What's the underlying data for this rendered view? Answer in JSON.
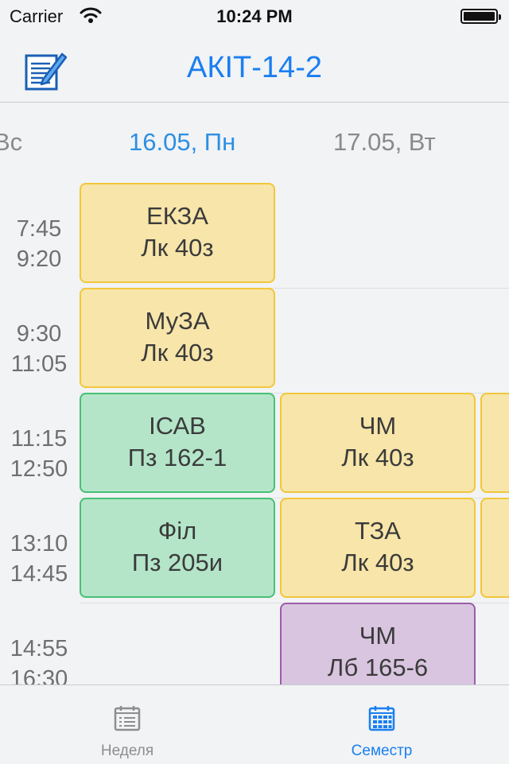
{
  "status_bar": {
    "carrier": "Carrier",
    "time": "10:24 PM"
  },
  "navbar": {
    "title": "АКІТ-14-2",
    "edit_icon": "edit-notes-icon"
  },
  "days": {
    "prev": "Вс",
    "current": "16.05, Пн",
    "next": "17.05, Вт"
  },
  "times": [
    {
      "start": "7:45",
      "end": "9:20"
    },
    {
      "start": "9:30",
      "end": "11:05"
    },
    {
      "start": "11:15",
      "end": "12:50"
    },
    {
      "start": "13:10",
      "end": "14:45"
    },
    {
      "start": "14:55",
      "end": "16:30"
    }
  ],
  "lessons": {
    "mon": [
      {
        "name": "ЕКЗА",
        "room": "Лк 40з",
        "color": "#f7e5a9"
      },
      {
        "name": "МуЗА",
        "room": "Лк 40з",
        "color": "#f7e5a9"
      },
      {
        "name": "ІСАВ",
        "room": "Пз 162-1",
        "color": "#b4e5c9"
      },
      {
        "name": "Філ",
        "room": "Пз 205и",
        "color": "#b4e5c9"
      }
    ],
    "tue": [
      {
        "name": "ЧМ",
        "room": "Лк 40з",
        "color": "#f7e5a9"
      },
      {
        "name": "ТЗА",
        "room": "Лк 40з",
        "color": "#f7e5a9"
      },
      {
        "name": "ЧМ",
        "room": "Лб 165-6",
        "color": "#d9c5e0"
      }
    ]
  },
  "tabs": [
    {
      "label": "Неделя",
      "icon": "list-calendar-icon",
      "active": false
    },
    {
      "label": "Семестр",
      "icon": "grid-calendar-icon",
      "active": true
    }
  ],
  "colors": {
    "accent": "#1a7ff0",
    "lecture": "#f7e5a9",
    "practice": "#b4e5c9",
    "lab": "#d9c5e0"
  }
}
